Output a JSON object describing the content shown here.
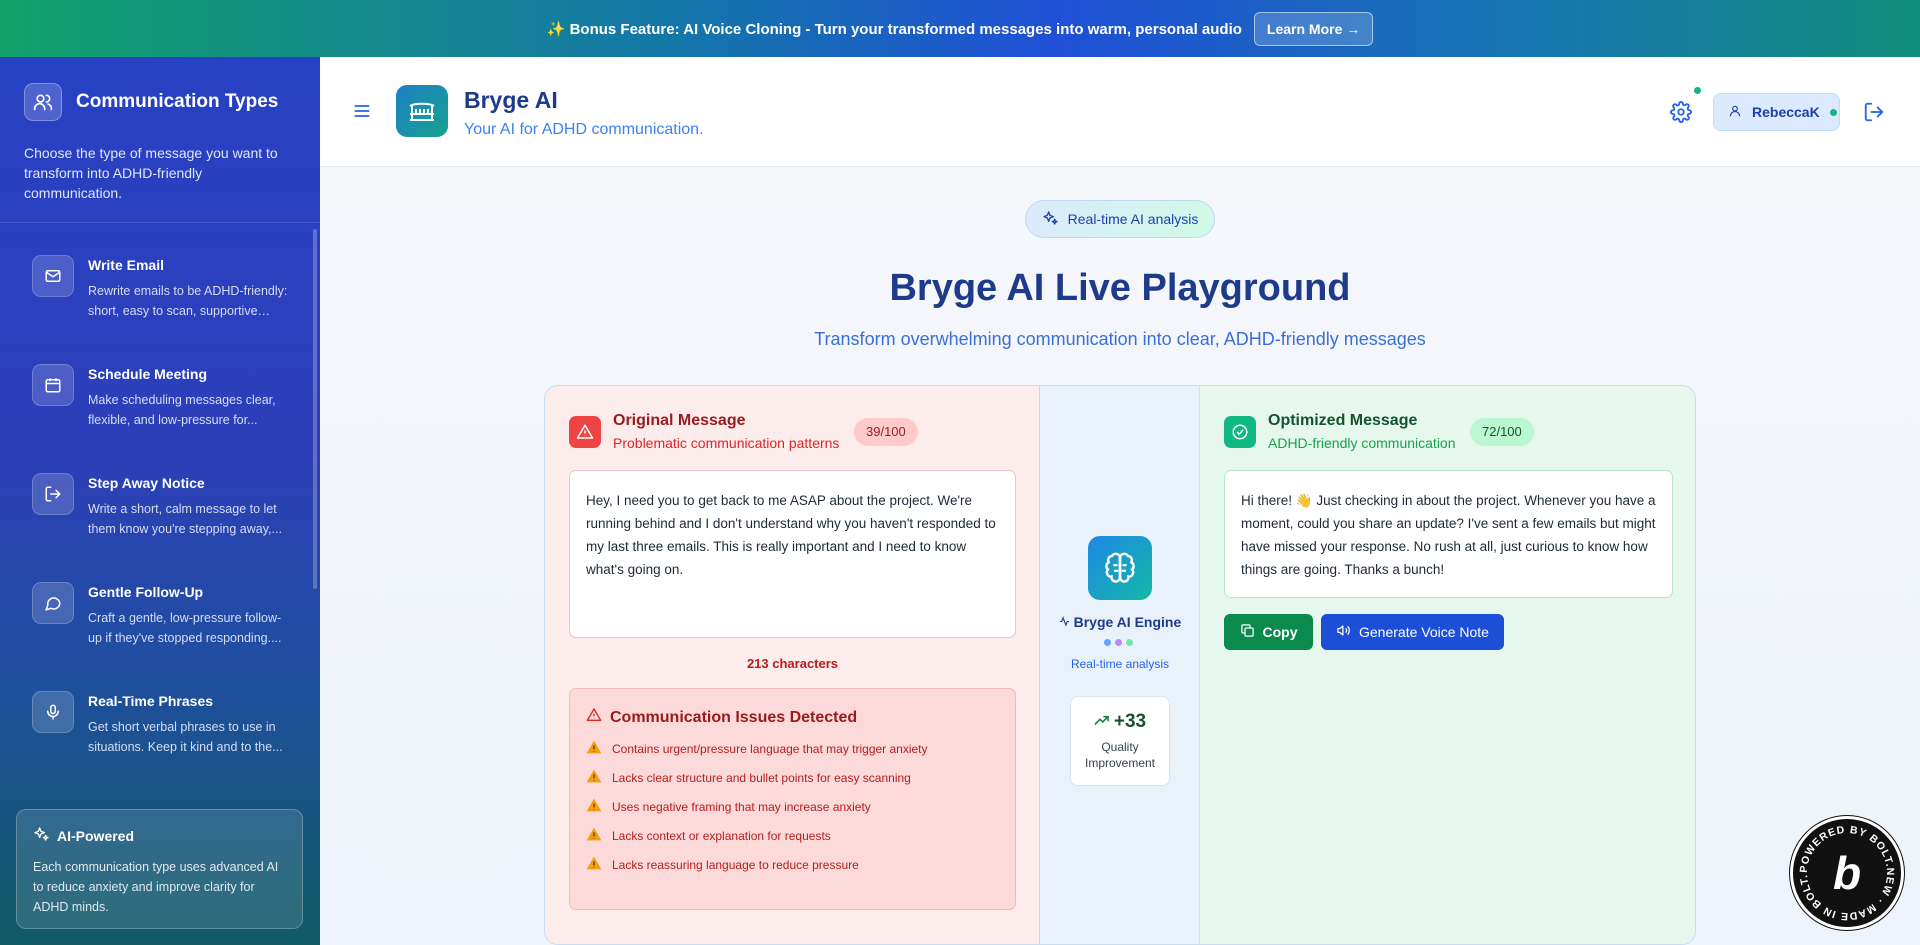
{
  "banner": {
    "text": "✨ Bonus Feature: AI Voice Cloning - Turn your transformed messages into warm, personal audio",
    "button": "Learn More →"
  },
  "sidebar": {
    "title": "Communication Types",
    "description": "Choose the type of message you want to transform into ADHD-friendly communication.",
    "items": [
      {
        "title": "Write Email",
        "desc": "Rewrite emails to be ADHD-friendly: short, easy to scan, supportive ton...",
        "icon": "mail-icon"
      },
      {
        "title": "Schedule Meeting",
        "desc": "Make scheduling messages clear, flexible, and low-pressure for...",
        "icon": "calendar-icon"
      },
      {
        "title": "Step Away Notice",
        "desc": "Write a short, calm message to let them know you're stepping away,...",
        "icon": "exit-icon"
      },
      {
        "title": "Gentle Follow-Up",
        "desc": "Craft a gentle, low-pressure follow-up if they've stopped responding....",
        "icon": "chat-icon"
      },
      {
        "title": "Real-Time Phrases",
        "desc": "Get short verbal phrases to use in situations. Keep it kind and to the...",
        "icon": "mic-icon"
      }
    ],
    "ai": {
      "title": "AI-Powered",
      "desc": "Each communication type uses advanced AI to reduce anxiety and improve clarity for ADHD minds."
    }
  },
  "header": {
    "app_title": "Bryge AI",
    "app_subtitle": "Your AI for ADHD communication.",
    "user": "RebeccaK"
  },
  "main": {
    "badge": "Real-time AI analysis",
    "title": "Bryge AI Live Playground",
    "subtitle": "Transform overwhelming communication into clear, ADHD-friendly messages",
    "original": {
      "title": "Original Message",
      "subtitle": "Problematic communication patterns",
      "score": "39/100",
      "text": "Hey, I need you to get back to me ASAP about the project. We're running behind and I don't understand why you haven't responded to my last three emails. This is really important and I need to know what's going on.",
      "char_count": "213 characters",
      "issues_title": "Communication Issues Detected",
      "issues": [
        "Contains urgent/pressure language that may trigger anxiety",
        "Lacks clear structure and bullet points for easy scanning",
        "Uses negative framing that may increase anxiety",
        "Lacks context or explanation for requests",
        "Lacks reassuring language to reduce pressure"
      ]
    },
    "engine": {
      "name": "Bryge AI Engine",
      "sub": "Real-time analysis",
      "quality_value": "+33",
      "quality_label": "Quality Improvement"
    },
    "optimized": {
      "title": "Optimized Message",
      "subtitle": "ADHD-friendly communication",
      "score": "72/100",
      "text": "Hi there! 👋 Just checking in about the project. Whenever you have a moment, could you share an update? I've sent a few emails but might have missed your response. No rush at all, just curious to know how things are going. Thanks a bunch!",
      "copy_label": "Copy",
      "voice_label": "Generate Voice Note"
    }
  },
  "colors": {
    "brand_blue": "#1e3a8a",
    "accent_blue": "#1d4ed8",
    "success_green": "#0b8a4d",
    "danger_red": "#dc2626"
  }
}
